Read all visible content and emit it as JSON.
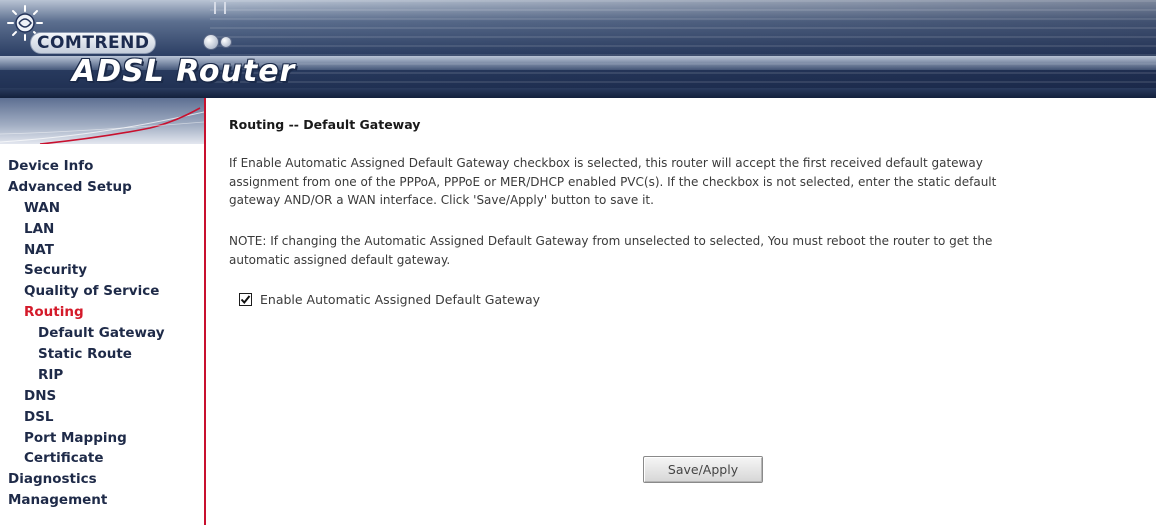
{
  "header": {
    "brand": "COMTREND",
    "product": "ADSL Router"
  },
  "sidebar": {
    "items": [
      {
        "label": "Device Info",
        "level": 1,
        "active": false
      },
      {
        "label": "Advanced Setup",
        "level": 1,
        "active": false
      },
      {
        "label": "WAN",
        "level": 2,
        "active": false
      },
      {
        "label": "LAN",
        "level": 2,
        "active": false
      },
      {
        "label": "NAT",
        "level": 2,
        "active": false
      },
      {
        "label": "Security",
        "level": 2,
        "active": false
      },
      {
        "label": "Quality of Service",
        "level": 2,
        "active": false
      },
      {
        "label": "Routing",
        "level": 2,
        "active": true
      },
      {
        "label": "Default Gateway",
        "level": 3,
        "active": false
      },
      {
        "label": "Static Route",
        "level": 3,
        "active": false
      },
      {
        "label": "RIP",
        "level": 3,
        "active": false
      },
      {
        "label": "DNS",
        "level": 2,
        "active": false
      },
      {
        "label": "DSL",
        "level": 2,
        "active": false
      },
      {
        "label": "Port Mapping",
        "level": 2,
        "active": false
      },
      {
        "label": "Certificate",
        "level": 2,
        "active": false
      },
      {
        "label": "Diagnostics",
        "level": 1,
        "active": false
      },
      {
        "label": "Management",
        "level": 1,
        "active": false
      }
    ]
  },
  "main": {
    "title": "Routing -- Default Gateway",
    "description_lines": [
      "If Enable Automatic Assigned Default Gateway checkbox is selected, this router will accept the first received default gateway",
      "assignment from one of the PPPoA, PPPoE or MER/DHCP enabled PVC(s). If the checkbox is not selected, enter the static default",
      "gateway AND/OR a WAN interface. Click 'Save/Apply' button to save it."
    ],
    "note_lines": [
      "NOTE: If changing the Automatic Assigned Default Gateway from unselected to selected, You must reboot the router to get the",
      "automatic assigned default gateway."
    ],
    "checkbox": {
      "label": "Enable Automatic Assigned Default Gateway",
      "checked": true
    },
    "save_button_label": "Save/Apply"
  },
  "colors": {
    "accent_red": "#d41a2a",
    "nav_text": "#1e2a48",
    "banner_dark": "#1d2d4f"
  }
}
